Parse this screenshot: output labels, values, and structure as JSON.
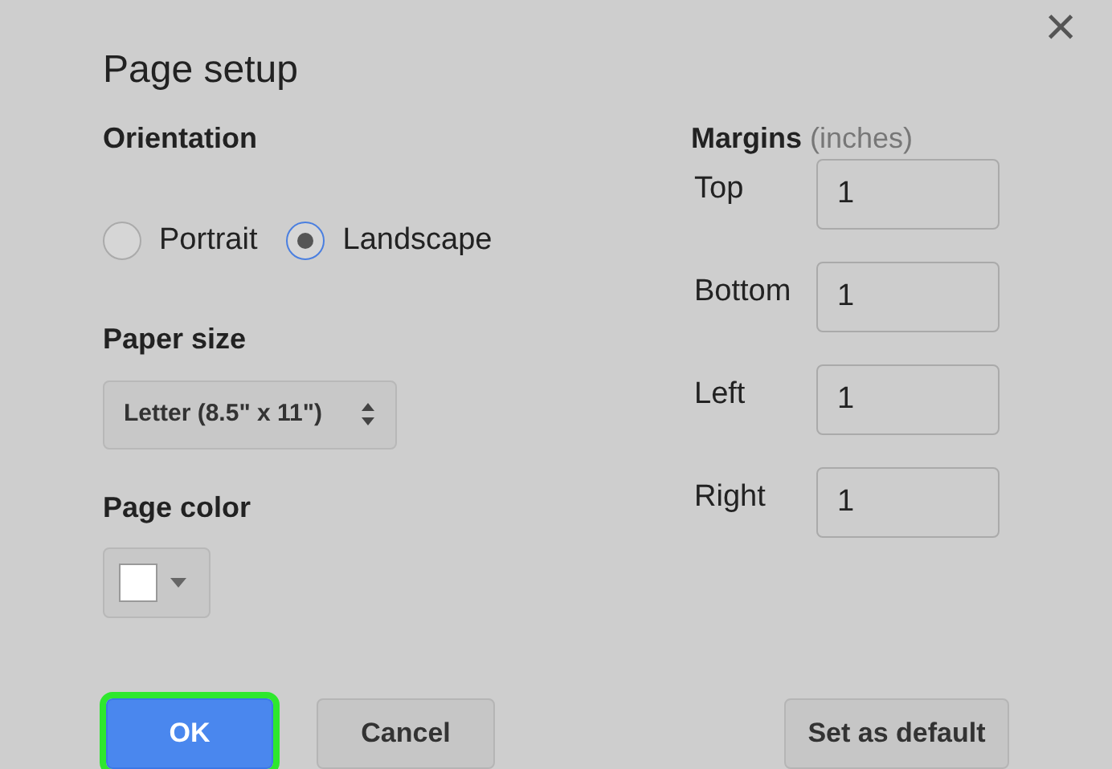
{
  "dialog": {
    "title": "Page setup",
    "close": "×"
  },
  "orientation": {
    "label": "Orientation",
    "options": [
      {
        "label": "Portrait",
        "selected": false
      },
      {
        "label": "Landscape",
        "selected": true
      }
    ]
  },
  "paper_size": {
    "label": "Paper size",
    "value": "Letter (8.5\" x 11\")"
  },
  "page_color": {
    "label": "Page color",
    "color": "#ffffff"
  },
  "margins": {
    "label": "Margins",
    "unit": "(inches)",
    "fields": [
      {
        "label": "Top",
        "value": "1"
      },
      {
        "label": "Bottom",
        "value": "1"
      },
      {
        "label": "Left",
        "value": "1"
      },
      {
        "label": "Right",
        "value": "1"
      }
    ]
  },
  "buttons": [
    {
      "label": "OK",
      "kind": "primary",
      "highlighted": true
    },
    {
      "label": "Cancel",
      "kind": "secondary",
      "highlighted": false
    },
    {
      "label": "Set as default",
      "kind": "secondary",
      "highlighted": false
    }
  ]
}
